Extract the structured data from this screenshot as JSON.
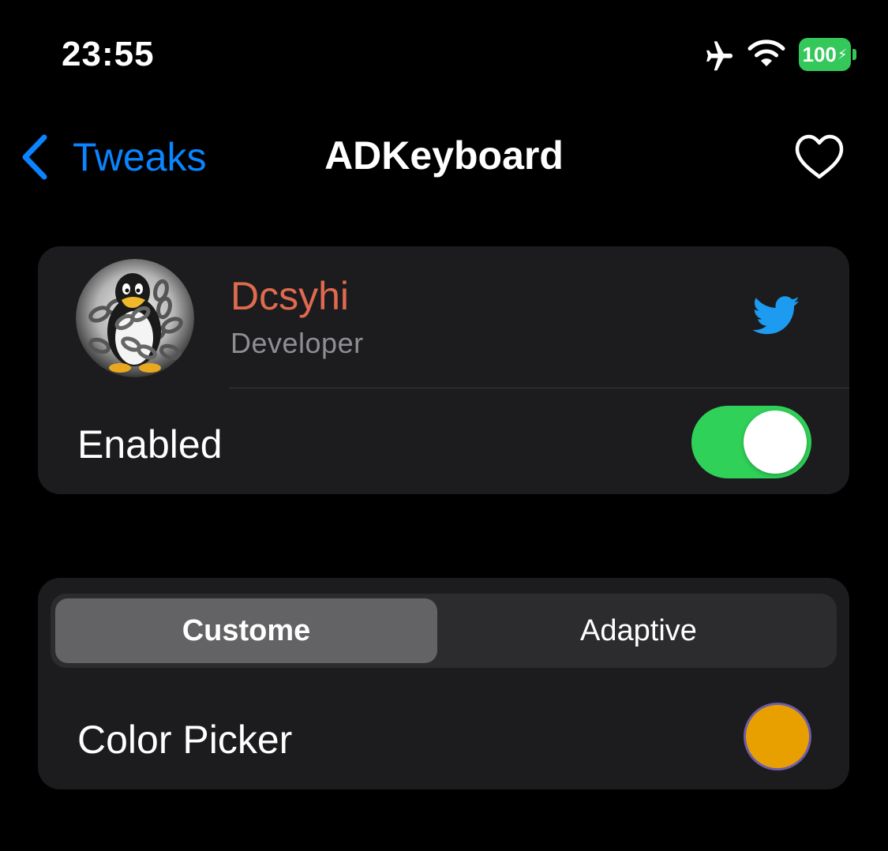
{
  "status_bar": {
    "time": "23:55",
    "battery": "100",
    "battery_color": "#34c759",
    "icons": [
      "airplane-icon",
      "wifi-icon",
      "battery-icon"
    ]
  },
  "nav": {
    "back_label": "Tweaks",
    "title": "ADKeyboard",
    "accent_color": "#0a84ff",
    "icons": [
      "chevron-left-icon",
      "heart-icon"
    ]
  },
  "developer": {
    "name": "Dcsyhi",
    "role": "Developer",
    "name_color": "#e06a4e",
    "social_icon": "twitter-icon"
  },
  "enabled": {
    "label": "Enabled",
    "value": true,
    "on_color": "#30d158"
  },
  "segmented": {
    "options": [
      "Custome",
      "Adaptive"
    ],
    "selected": "Custome"
  },
  "color_picker": {
    "label": "Color Picker",
    "value": "#e8a000"
  }
}
